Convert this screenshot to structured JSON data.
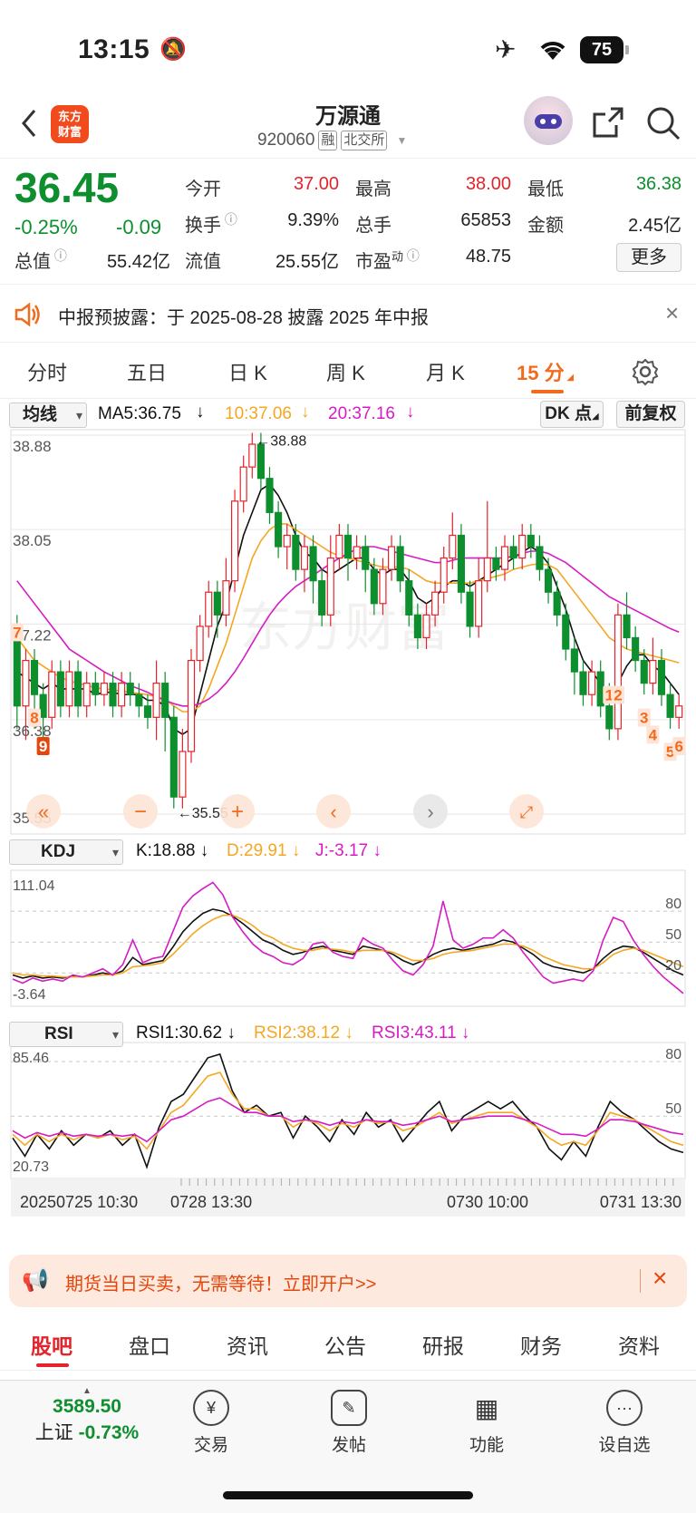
{
  "status_bar": {
    "time": "13:15",
    "battery": "75"
  },
  "header": {
    "logo_line1": "东方",
    "logo_line2": "财富",
    "stock_name": "万源通",
    "stock_code": "920060",
    "tag_margin": "融",
    "tag_exchange": "北交所"
  },
  "quote": {
    "price": "36.45",
    "change_pct": "-0.25%",
    "change": "-0.09",
    "open_label": "今开",
    "open": "37.00",
    "high_label": "最高",
    "high": "38.00",
    "low_label": "最低",
    "low": "36.38",
    "turnover_label": "换手",
    "turnover": "9.39%",
    "volume_label": "总手",
    "volume": "65853",
    "amount_label": "金额",
    "amount": "2.45亿",
    "mktcap_label": "总值",
    "mktcap": "55.42亿",
    "float_label": "流值",
    "float_cap": "25.55亿",
    "pe_label": "市盈",
    "pe_sup": "动",
    "pe": "48.75",
    "more_label": "更多"
  },
  "notice": {
    "text": "中报预披露：于 2025-08-28 披露 2025 年中报"
  },
  "tabs": [
    "分时",
    "五日",
    "日 K",
    "周 K",
    "月 K",
    "15 分"
  ],
  "ma_bar": {
    "selector": "均线",
    "ma5": "MA5:36.75",
    "ma10": "10:37.06",
    "ma20": "20:37.16",
    "dk_label": "DK 点",
    "adjust_label": "前复权"
  },
  "kdj_bar": {
    "selector": "KDJ",
    "k": "K:18.88",
    "d": "D:29.91",
    "j": "J:-3.17"
  },
  "rsi_bar": {
    "selector": "RSI",
    "rsi1": "RSI1:30.62",
    "rsi2": "RSI2:38.12",
    "rsi3": "RSI3:43.11"
  },
  "colors": {
    "up": "#e5232b",
    "down": "#0d8f2e",
    "ma5": "#111111",
    "ma10": "#f5a623",
    "ma20": "#d51cc4",
    "accent": "#f26b1d"
  },
  "chart_data": [
    {
      "type": "candlestick",
      "name_label": "15 分",
      "ylim": [
        35.55,
        38.88
      ],
      "y_ticks": [
        "38.88",
        "38.05",
        "37.22",
        "36.38",
        "35.55"
      ],
      "high_annotation": "38.88",
      "low_annotation": "35.55",
      "x_ticks": [
        "20250725 10:30",
        "0728 13:30",
        "0730 10:00",
        "0731 13:30"
      ],
      "sequence_marks": [
        "7",
        "8",
        "9",
        "1",
        "2",
        "3",
        "4",
        "5",
        "6"
      ],
      "candles": [
        [
          37.2,
          36.5,
          37.3,
          36.3
        ],
        [
          36.5,
          36.9,
          37.0,
          36.2
        ],
        [
          36.9,
          36.6,
          37.0,
          36.3
        ],
        [
          36.6,
          36.4,
          36.7,
          36.2
        ],
        [
          36.4,
          36.8,
          36.9,
          36.3
        ],
        [
          36.8,
          36.5,
          36.9,
          36.4
        ],
        [
          36.5,
          36.8,
          36.9,
          36.4
        ],
        [
          36.8,
          36.5,
          36.9,
          36.4
        ],
        [
          36.5,
          36.7,
          36.8,
          36.4
        ],
        [
          36.7,
          36.6,
          36.8,
          36.5
        ],
        [
          36.6,
          36.7,
          36.8,
          36.5
        ],
        [
          36.7,
          36.5,
          36.8,
          36.4
        ],
        [
          36.5,
          36.7,
          36.8,
          36.4
        ],
        [
          36.7,
          36.6,
          36.8,
          36.5
        ],
        [
          36.6,
          36.5,
          36.7,
          36.4
        ],
        [
          36.5,
          36.4,
          36.6,
          36.3
        ],
        [
          36.4,
          36.7,
          36.9,
          36.2
        ],
        [
          36.7,
          36.4,
          36.8,
          36.1
        ],
        [
          36.4,
          35.7,
          36.5,
          35.6
        ],
        [
          35.7,
          36.1,
          36.3,
          35.6
        ],
        [
          36.1,
          36.9,
          37.0,
          36.0
        ],
        [
          36.9,
          37.2,
          37.3,
          36.8
        ],
        [
          37.2,
          37.5,
          37.6,
          37.1
        ],
        [
          37.5,
          37.3,
          37.6,
          37.1
        ],
        [
          37.3,
          37.6,
          37.8,
          37.2
        ],
        [
          37.6,
          38.3,
          38.4,
          37.5
        ],
        [
          38.3,
          38.6,
          38.7,
          38.2
        ],
        [
          38.6,
          38.8,
          38.9,
          38.5
        ],
        [
          38.8,
          38.5,
          38.9,
          38.4
        ],
        [
          38.5,
          38.2,
          38.6,
          38.1
        ],
        [
          38.2,
          37.9,
          38.3,
          37.8
        ],
        [
          37.9,
          38.0,
          38.1,
          37.7
        ],
        [
          38.0,
          37.7,
          38.1,
          37.6
        ],
        [
          37.7,
          37.9,
          38.0,
          37.5
        ],
        [
          37.9,
          37.6,
          38.0,
          37.4
        ],
        [
          37.6,
          37.3,
          37.7,
          37.2
        ],
        [
          37.3,
          37.8,
          38.0,
          37.2
        ],
        [
          37.8,
          38.0,
          38.1,
          37.7
        ],
        [
          38.0,
          37.8,
          38.1,
          37.6
        ],
        [
          37.8,
          37.9,
          38.0,
          37.7
        ],
        [
          37.9,
          37.7,
          38.0,
          37.5
        ],
        [
          37.7,
          37.4,
          37.8,
          37.3
        ],
        [
          37.4,
          37.7,
          37.8,
          37.3
        ],
        [
          37.7,
          37.9,
          38.0,
          37.6
        ],
        [
          37.9,
          37.6,
          38.0,
          37.5
        ],
        [
          37.6,
          37.3,
          37.7,
          37.2
        ],
        [
          37.3,
          37.1,
          37.4,
          37.0
        ],
        [
          37.1,
          37.3,
          37.4,
          37.0
        ],
        [
          37.3,
          37.5,
          37.6,
          37.2
        ],
        [
          37.5,
          37.8,
          37.9,
          37.4
        ],
        [
          37.8,
          38.0,
          38.2,
          37.7
        ],
        [
          38.0,
          37.5,
          38.1,
          37.4
        ],
        [
          37.5,
          37.2,
          37.6,
          37.1
        ],
        [
          37.2,
          37.6,
          37.8,
          37.1
        ],
        [
          37.6,
          37.8,
          38.3,
          37.5
        ],
        [
          37.8,
          37.7,
          37.9,
          37.6
        ],
        [
          37.7,
          37.9,
          38.0,
          37.6
        ],
        [
          37.9,
          37.8,
          38.0,
          37.7
        ],
        [
          37.8,
          38.0,
          38.1,
          37.7
        ],
        [
          38.0,
          37.9,
          38.1,
          37.8
        ],
        [
          37.9,
          37.7,
          38.0,
          37.6
        ],
        [
          37.7,
          37.5,
          37.8,
          37.4
        ],
        [
          37.5,
          37.3,
          37.6,
          37.2
        ],
        [
          37.3,
          37.0,
          37.4,
          36.9
        ],
        [
          37.0,
          36.8,
          37.1,
          36.6
        ],
        [
          36.8,
          36.6,
          36.9,
          36.5
        ],
        [
          36.6,
          36.8,
          36.9,
          36.5
        ],
        [
          36.8,
          36.5,
          36.9,
          36.4
        ],
        [
          36.5,
          36.3,
          36.7,
          36.2
        ],
        [
          36.3,
          37.3,
          37.4,
          36.2
        ],
        [
          37.3,
          37.1,
          37.5,
          37.0
        ],
        [
          37.1,
          36.9,
          37.2,
          36.8
        ],
        [
          36.9,
          36.7,
          37.0,
          36.6
        ],
        [
          36.7,
          36.9,
          37.1,
          36.6
        ],
        [
          36.9,
          36.6,
          37.0,
          36.5
        ],
        [
          36.6,
          36.4,
          36.7,
          36.3
        ],
        [
          36.4,
          36.5,
          36.6,
          36.3
        ]
      ],
      "ma5": [
        36.8,
        36.75,
        36.7,
        36.65,
        36.7,
        36.65,
        36.65,
        36.65,
        36.65,
        36.6,
        36.62,
        36.62,
        36.6,
        36.6,
        36.6,
        36.55,
        36.55,
        36.5,
        36.3,
        36.25,
        36.3,
        36.6,
        36.9,
        37.2,
        37.4,
        37.7,
        38.0,
        38.2,
        38.4,
        38.45,
        38.35,
        38.2,
        38.0,
        37.85,
        37.8,
        37.7,
        37.65,
        37.7,
        37.75,
        37.8,
        37.8,
        37.7,
        37.65,
        37.7,
        37.7,
        37.6,
        37.45,
        37.4,
        37.45,
        37.55,
        37.6,
        37.6,
        37.55,
        37.6,
        37.65,
        37.7,
        37.75,
        37.8,
        37.85,
        37.9,
        37.85,
        37.75,
        37.55,
        37.35,
        37.1,
        36.9,
        36.8,
        36.7,
        36.6,
        36.7,
        36.85,
        36.95,
        36.95,
        36.85,
        36.8,
        36.7,
        36.6
      ],
      "ma10": [
        37.1,
        37.0,
        36.9,
        36.85,
        36.8,
        36.75,
        36.72,
        36.7,
        36.68,
        36.66,
        36.65,
        36.64,
        36.63,
        36.62,
        36.61,
        36.6,
        36.58,
        36.56,
        36.5,
        36.45,
        36.45,
        36.5,
        36.65,
        36.85,
        37.05,
        37.3,
        37.55,
        37.8,
        37.95,
        38.05,
        38.1,
        38.1,
        38.05,
        38.0,
        37.95,
        37.9,
        37.85,
        37.82,
        37.8,
        37.78,
        37.76,
        37.74,
        37.72,
        37.72,
        37.72,
        37.7,
        37.65,
        37.6,
        37.58,
        37.58,
        37.58,
        37.58,
        37.58,
        37.6,
        37.62,
        37.64,
        37.66,
        37.7,
        37.72,
        37.74,
        37.75,
        37.74,
        37.7,
        37.6,
        37.5,
        37.4,
        37.3,
        37.2,
        37.1,
        37.05,
        37.0,
        36.98,
        36.96,
        36.94,
        36.92,
        36.9,
        36.88
      ],
      "ma20": [
        37.6,
        37.5,
        37.4,
        37.3,
        37.2,
        37.1,
        37.0,
        36.95,
        36.9,
        36.85,
        36.8,
        36.76,
        36.72,
        36.68,
        36.65,
        36.62,
        36.58,
        36.55,
        36.52,
        36.5,
        36.5,
        36.52,
        36.56,
        36.62,
        36.7,
        36.8,
        36.92,
        37.05,
        37.18,
        37.3,
        37.4,
        37.48,
        37.55,
        37.6,
        37.65,
        37.7,
        37.75,
        37.8,
        37.84,
        37.88,
        37.9,
        37.9,
        37.88,
        37.86,
        37.84,
        37.82,
        37.8,
        37.78,
        37.76,
        37.76,
        37.78,
        37.8,
        37.8,
        37.8,
        37.8,
        37.8,
        37.8,
        37.82,
        37.84,
        37.86,
        37.86,
        37.84,
        37.8,
        37.76,
        37.7,
        37.64,
        37.58,
        37.52,
        37.46,
        37.42,
        37.38,
        37.34,
        37.3,
        37.26,
        37.22,
        37.18,
        37.15
      ]
    },
    {
      "type": "line",
      "name_label": "KDJ",
      "ylim": [
        -3.64,
        111.04
      ],
      "y_ticks": [
        "111.04",
        "-3.64"
      ],
      "ref_lines": [
        80,
        50,
        20
      ],
      "series": [
        {
          "name": "K",
          "values": [
            18,
            15,
            17,
            15,
            16,
            15,
            17,
            16,
            18,
            20,
            18,
            22,
            35,
            28,
            30,
            32,
            45,
            60,
            70,
            78,
            82,
            80,
            75,
            68,
            60,
            52,
            48,
            42,
            38,
            40,
            44,
            46,
            42,
            40,
            38,
            46,
            44,
            42,
            38,
            32,
            28,
            32,
            38,
            42,
            44,
            42,
            44,
            46,
            48,
            52,
            50,
            44,
            38,
            30,
            26,
            24,
            22,
            20,
            24,
            34,
            42,
            46,
            45,
            40,
            34,
            28,
            22,
            18
          ]
        },
        {
          "name": "D",
          "values": [
            20,
            18,
            18,
            17,
            17,
            16,
            16,
            16,
            17,
            18,
            18,
            20,
            26,
            27,
            28,
            30,
            38,
            48,
            58,
            66,
            72,
            76,
            76,
            72,
            66,
            58,
            54,
            48,
            44,
            42,
            42,
            44,
            43,
            42,
            40,
            42,
            42,
            42,
            40,
            36,
            32,
            32,
            34,
            38,
            40,
            41,
            42,
            44,
            46,
            48,
            48,
            46,
            42,
            36,
            32,
            28,
            26,
            24,
            24,
            30,
            38,
            42,
            44,
            42,
            38,
            34,
            30,
            26
          ]
        },
        {
          "name": "J",
          "values": [
            14,
            10,
            15,
            12,
            14,
            12,
            18,
            16,
            20,
            24,
            18,
            28,
            52,
            30,
            34,
            36,
            60,
            84,
            95,
            102,
            108,
            96,
            74,
            60,
            48,
            40,
            36,
            30,
            28,
            34,
            48,
            50,
            40,
            36,
            34,
            54,
            48,
            44,
            32,
            22,
            18,
            28,
            46,
            90,
            52,
            44,
            48,
            54,
            54,
            62,
            54,
            40,
            28,
            16,
            10,
            12,
            14,
            12,
            22,
            52,
            74,
            70,
            52,
            38,
            26,
            16,
            8,
            0
          ]
        }
      ]
    },
    {
      "type": "line",
      "name_label": "RSI",
      "ylim": [
        20.73,
        85.46
      ],
      "y_ticks": [
        "85.46",
        "20.73"
      ],
      "ref_lines": [
        80,
        50
      ],
      "series": [
        {
          "name": "RSI1",
          "values": [
            38,
            28,
            40,
            32,
            42,
            34,
            40,
            38,
            42,
            34,
            40,
            22,
            44,
            58,
            62,
            72,
            82,
            84,
            64,
            52,
            56,
            50,
            52,
            38,
            50,
            44,
            36,
            48,
            40,
            52,
            44,
            48,
            36,
            44,
            52,
            58,
            42,
            50,
            54,
            58,
            54,
            58,
            50,
            44,
            32,
            26,
            36,
            28,
            44,
            58,
            52,
            48,
            42,
            36,
            32,
            30
          ]
        },
        {
          "name": "RSI2",
          "values": [
            40,
            34,
            40,
            36,
            40,
            37,
            40,
            38,
            40,
            37,
            39,
            32,
            42,
            52,
            56,
            64,
            72,
            74,
            62,
            54,
            54,
            50,
            50,
            44,
            48,
            46,
            42,
            46,
            44,
            48,
            46,
            47,
            42,
            44,
            48,
            52,
            46,
            48,
            50,
            52,
            52,
            52,
            48,
            44,
            38,
            34,
            36,
            34,
            42,
            52,
            50,
            48,
            44,
            40,
            36,
            34
          ]
        },
        {
          "name": "RSI3",
          "values": [
            42,
            38,
            41,
            39,
            41,
            39,
            40,
            39,
            40,
            39,
            40,
            36,
            42,
            48,
            50,
            54,
            58,
            60,
            56,
            52,
            52,
            50,
            50,
            47,
            48,
            47,
            45,
            47,
            46,
            48,
            47,
            47,
            45,
            46,
            48,
            50,
            47,
            48,
            49,
            50,
            50,
            50,
            48,
            46,
            43,
            40,
            40,
            39,
            43,
            48,
            48,
            47,
            45,
            43,
            41,
            40
          ]
        }
      ]
    }
  ],
  "ad": {
    "text": "期货当日买卖，无需等待！立即开户>>"
  },
  "bottom_tabs": [
    "股吧",
    "盘口",
    "资讯",
    "公告",
    "研报",
    "财务",
    "资料"
  ],
  "dock": {
    "index_value": "3589.50",
    "index_name": "上证",
    "index_change": "-0.73%",
    "trade": "交易",
    "post": "发帖",
    "functions": "功能",
    "watchlist": "设自选"
  }
}
